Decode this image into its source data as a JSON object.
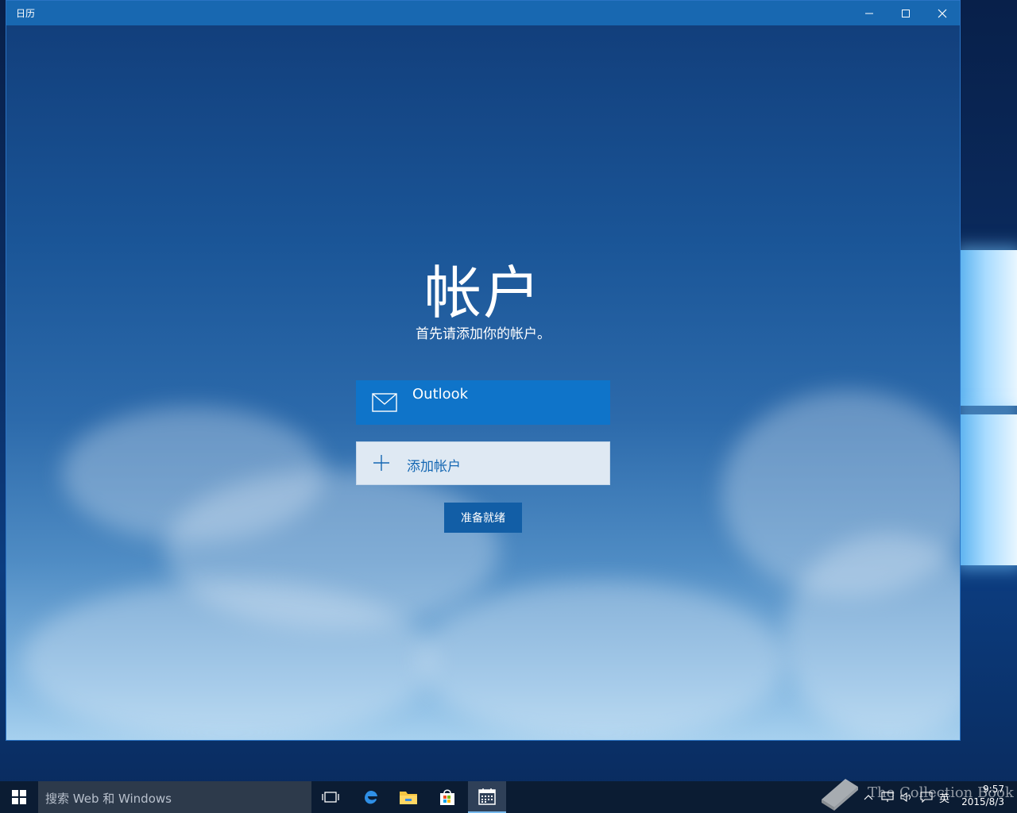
{
  "window": {
    "title": "日历"
  },
  "main": {
    "heading": "帐户",
    "subheading": "首先请添加你的帐户。",
    "accounts": [
      {
        "label": "Outlook",
        "icon": "mail-icon"
      }
    ],
    "add_account_label": "添加帐户",
    "ready_button_label": "准备就绪"
  },
  "taskbar": {
    "search_placeholder": "搜索 Web 和 Windows",
    "input_indicator": "英",
    "clock_time": "9:57",
    "clock_date": "2015/8/3"
  },
  "watermark": {
    "text": "The Collection Book"
  },
  "colors": {
    "accent": "#0f74c9",
    "titlebar": "#1868b1",
    "taskbar": "#0b1c33"
  }
}
